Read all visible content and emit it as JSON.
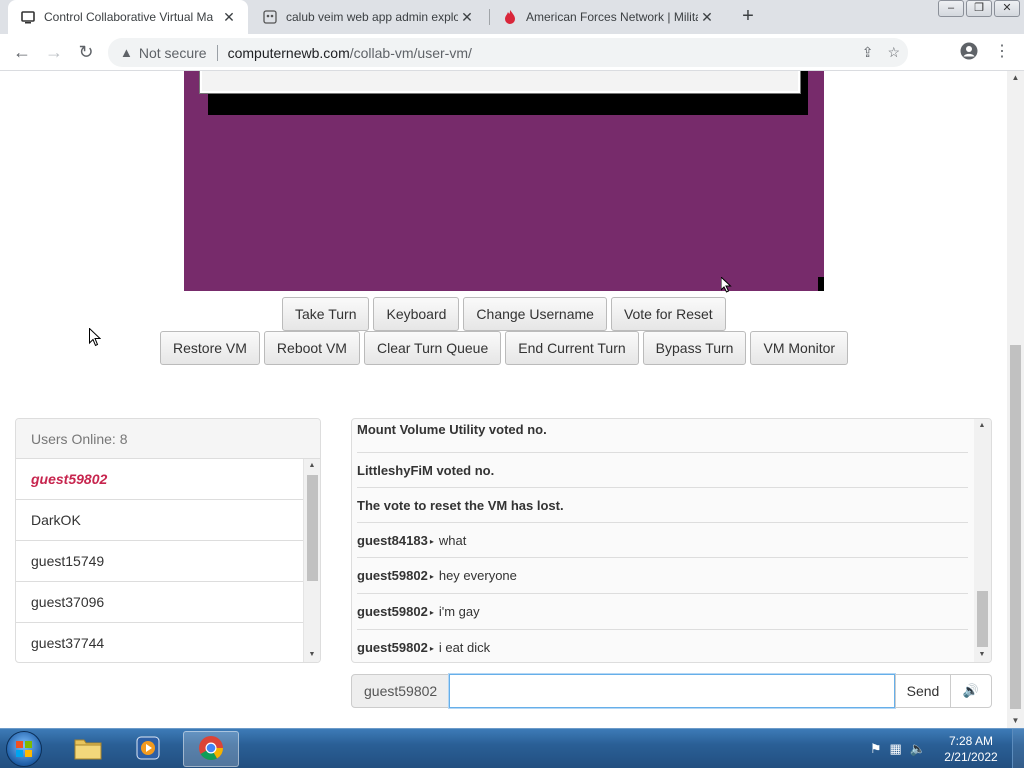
{
  "browser": {
    "tabs": [
      {
        "title": "Control Collaborative Virtual Ma",
        "favicon": "vm-logo-icon",
        "active": true
      },
      {
        "title": "calub veim web app admin explo",
        "favicon": "globe-icon",
        "active": false
      },
      {
        "title": "American Forces Network | Milita",
        "favicon": "flame-icon",
        "active": false
      }
    ],
    "security_label": "Not secure",
    "url_host": "computernewb.com",
    "url_path": "/collab-vm/user-vm/"
  },
  "controls": {
    "row1": [
      "Take Turn",
      "Keyboard",
      "Change Username",
      "Vote for Reset"
    ],
    "row2": [
      "Restore VM",
      "Reboot VM",
      "Clear Turn Queue",
      "End Current Turn",
      "Bypass Turn",
      "VM Monitor"
    ]
  },
  "users": {
    "header": "Users Online: 8",
    "list": [
      "guest59802",
      "DarkOK",
      "guest15749",
      "guest37096",
      "guest37744"
    ]
  },
  "chat": {
    "messages": [
      {
        "text": "Mount Volume Utility voted no."
      },
      {
        "text": "LittleshyFiM voted no."
      },
      {
        "text": "The vote to reset the VM has lost."
      },
      {
        "user": "guest84183",
        "text": "what"
      },
      {
        "user": "guest59802",
        "text": "hey everyone"
      },
      {
        "user": "guest59802",
        "text": "i'm gay"
      },
      {
        "user": "guest59802",
        "text": "i eat dick"
      }
    ],
    "username": "guest59802",
    "input_value": "",
    "send_label": "Send"
  },
  "taskbar": {
    "time": "7:28 AM",
    "date": "2/21/2022"
  },
  "colors": {
    "vm_desktop": "#772b6b",
    "self_user": "#c7254e"
  }
}
